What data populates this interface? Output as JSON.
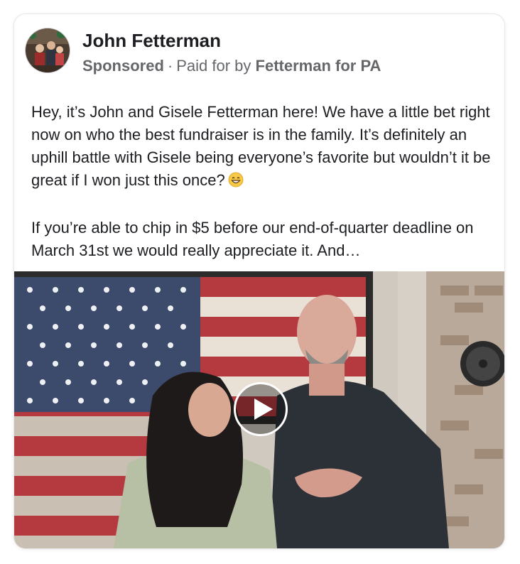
{
  "post": {
    "author": "John Fetterman",
    "sponsored_label": "Sponsored",
    "separator": "·",
    "paid_for_prefix": "Paid for by",
    "paid_for_org": "Fetterman for PA",
    "paragraph_1": "Hey, it’s John and Gisele Fetterman here! We have a little bet right now on who the best fundraiser is in the family. It’s definitely an uphill battle with Gisele being everyone’s favorite but wouldn’t it be great if I won just this once?",
    "paragraph_2": "If you’re able to chip in $5 before our end-of-quarter deadline on March 31st we would really appreciate it. And…"
  },
  "icons": {
    "emoji": "grinning-face-icon",
    "play": "play-icon"
  },
  "colors": {
    "primary_text": "#1c1e21",
    "secondary_text": "#65676b",
    "card_border": "#e6e7ea"
  }
}
